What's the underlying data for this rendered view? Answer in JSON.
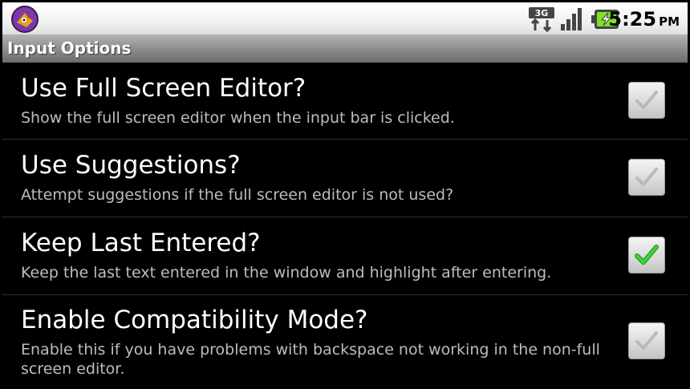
{
  "status_bar": {
    "app_icon": "app-logo-icon",
    "network_icon": "3g-data-icon",
    "network_label": "3G",
    "signal_icon": "signal-strength-icon",
    "battery_icon": "battery-charging-icon",
    "time": "5:25",
    "ampm": "PM"
  },
  "title_bar": {
    "title": "Input Options"
  },
  "preferences": [
    {
      "title": "Use Full Screen Editor?",
      "summary": "Show the full screen editor when the input bar is clicked.",
      "checked": false
    },
    {
      "title": "Use Suggestions?",
      "summary": "Attempt suggestions if the full screen editor is not used?",
      "checked": false
    },
    {
      "title": "Keep Last Entered?",
      "summary": "Keep the last text entered in the window and highlight after entering.",
      "checked": true
    },
    {
      "title": "Enable Compatibility Mode?",
      "summary": "Enable this if you have problems with backspace not working in the non-full screen editor.",
      "checked": false
    }
  ],
  "colors": {
    "check_on": "#3fd23b",
    "check_off": "#b9b9b9",
    "background": "#000000",
    "summary_text": "#bdbdbd"
  }
}
